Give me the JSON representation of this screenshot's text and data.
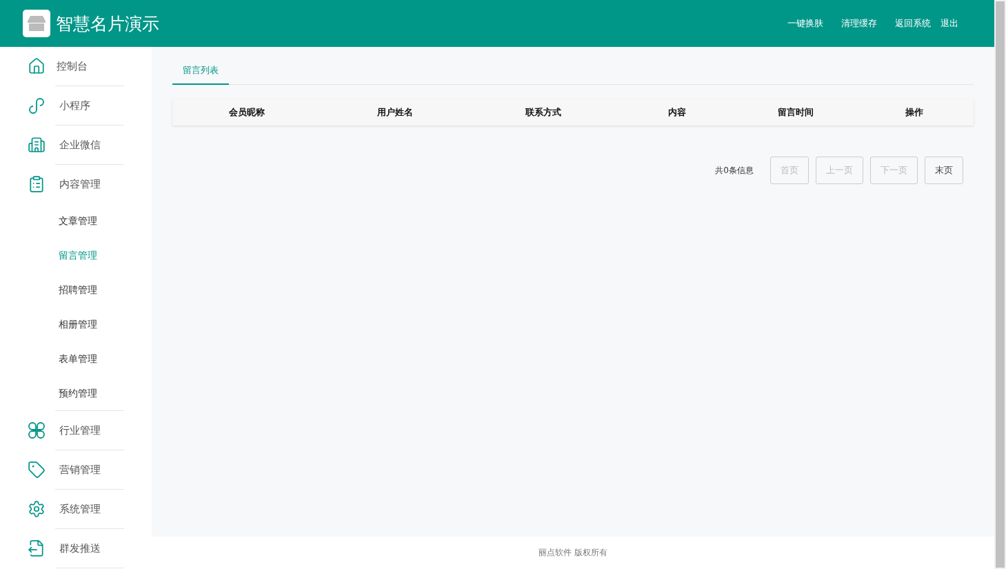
{
  "header": {
    "title": "智慧名片演示",
    "links": [
      "一键换肤",
      "清理缓存",
      "返回系统",
      "退出"
    ]
  },
  "sidebar": {
    "items": [
      {
        "label": "控制台"
      },
      {
        "label": "小程序"
      },
      {
        "label": "企业微信"
      },
      {
        "label": "内容管理",
        "children": [
          {
            "label": "文章管理",
            "selected": false
          },
          {
            "label": "留言管理",
            "selected": true
          },
          {
            "label": "招聘管理",
            "selected": false
          },
          {
            "label": "相册管理",
            "selected": false
          },
          {
            "label": "表单管理",
            "selected": false
          },
          {
            "label": "预约管理",
            "selected": false
          }
        ]
      },
      {
        "label": "行业管理"
      },
      {
        "label": "营销管理"
      },
      {
        "label": "系统管理"
      },
      {
        "label": "群发推送"
      }
    ]
  },
  "tabs": [
    {
      "label": "留言列表",
      "selected": true
    }
  ],
  "table": {
    "columns": [
      "会员昵称",
      "用户姓名",
      "联系方式",
      "内容",
      "留言时间",
      "操作"
    ]
  },
  "pagination": {
    "summary": "共0条信息",
    "buttons": [
      {
        "label": "首页",
        "disabled": true
      },
      {
        "label": "上一页",
        "disabled": true
      },
      {
        "label": "下一页",
        "disabled": true
      },
      {
        "label": "末页",
        "disabled": false
      }
    ]
  },
  "footer": "丽点软件 版权所有"
}
